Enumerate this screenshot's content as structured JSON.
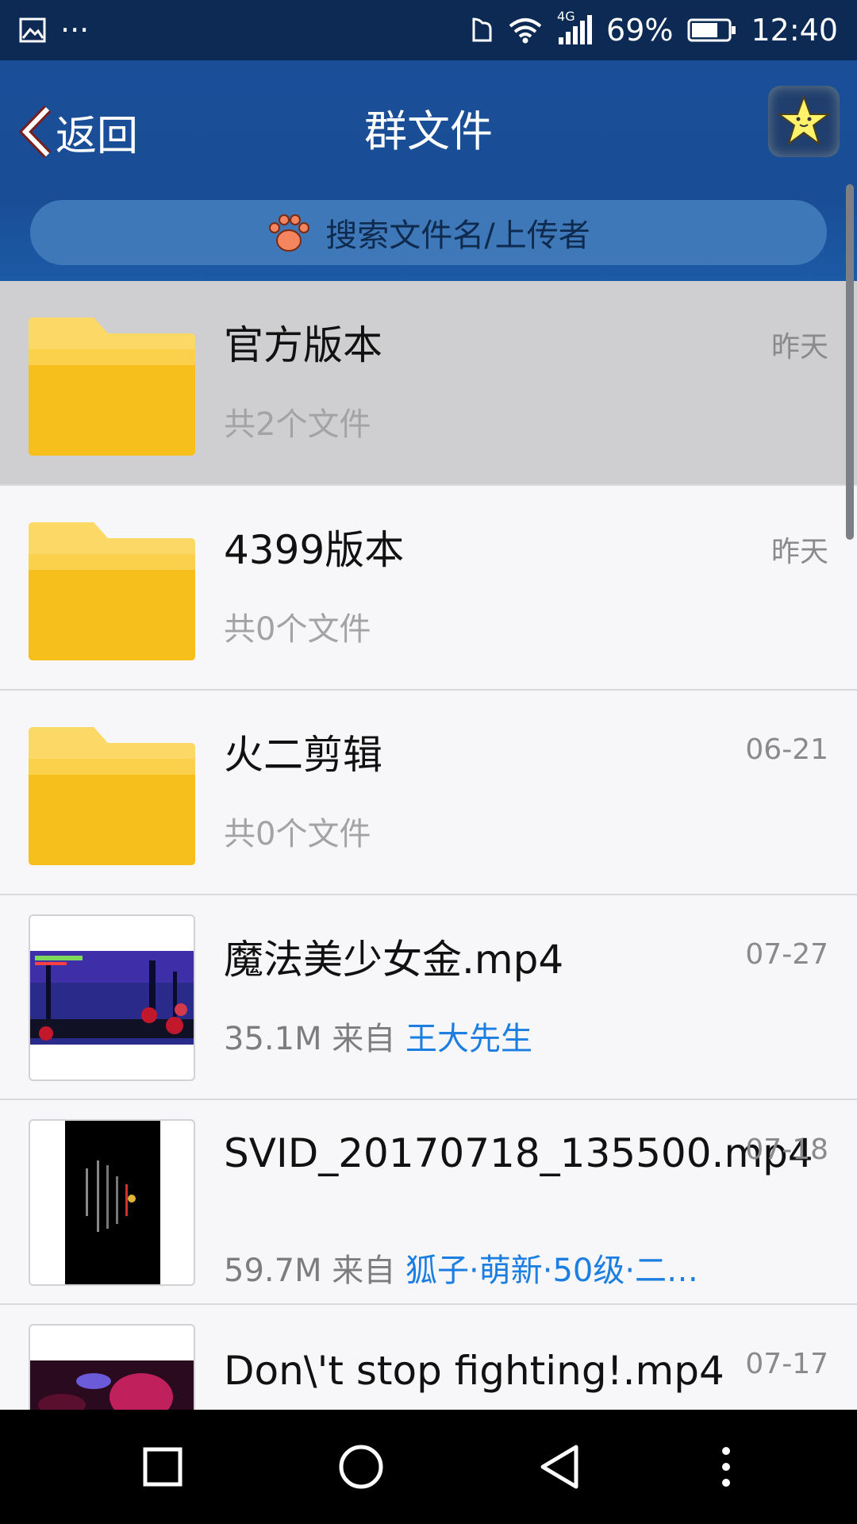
{
  "status_bar": {
    "dots": "···",
    "network": "4G",
    "battery": "69%",
    "time": "12:40"
  },
  "header": {
    "back_label": "返回",
    "title": "群文件"
  },
  "search": {
    "placeholder": "搜索文件名/上传者"
  },
  "files": [
    {
      "kind": "folder",
      "name": "官方版本",
      "sub": "共2个文件",
      "date": "昨天",
      "selected": true
    },
    {
      "kind": "folder",
      "name": "4399版本",
      "sub": "共0个文件",
      "date": "昨天"
    },
    {
      "kind": "folder",
      "name": "火二剪辑",
      "sub": "共0个文件",
      "date": "06-21"
    },
    {
      "kind": "video",
      "name": "魔法美少女金.mp4",
      "size": "35.1M",
      "from": "来自",
      "uploader": "王大先生",
      "date": "07-27"
    },
    {
      "kind": "video",
      "name": "SVID_20170718_135500.mp4",
      "size": "59.7M",
      "from": "来自",
      "uploader": "狐子·萌新·50级·二…",
      "date": "07-18"
    },
    {
      "kind": "video",
      "name": "Don\\'t stop fighting!.mp4",
      "date": "07-17"
    }
  ],
  "colors": {
    "header_blue": "#1a4f98",
    "status_bar": "#0d2a55",
    "folder_yellow": "#f6bf1b",
    "uploader_link": "#1b7ee0"
  }
}
